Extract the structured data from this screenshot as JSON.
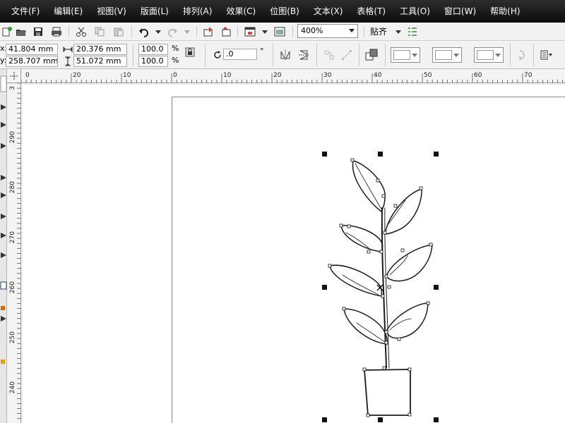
{
  "menu": [
    "文件(F)",
    "编辑(E)",
    "视图(V)",
    "版面(L)",
    "排列(A)",
    "效果(C)",
    "位图(B)",
    "文本(X)",
    "表格(T)",
    "工具(O)",
    "窗口(W)",
    "帮助(H)"
  ],
  "toolbar": {
    "zoom_value": "400%",
    "snap_label": "贴齐"
  },
  "property_bar": {
    "x_label": "x:",
    "y_label": "y:",
    "x_value": "41.804 mm",
    "y_value": "258.707 mm",
    "width_value": "20.376 mm",
    "height_value": "51.072 mm",
    "scale_x": "100.0",
    "scale_y": "100.0",
    "percent": "%",
    "rotation_value": ".0",
    "degree": "°"
  },
  "ruler": {
    "h_labels": [
      "0",
      "20",
      "10",
      "0",
      "10",
      "20",
      "30",
      "40",
      "50",
      "60",
      "70"
    ],
    "v_labels": [
      "3",
      "290",
      "280",
      "270",
      "260",
      "250",
      "240"
    ]
  },
  "colors": {
    "menubar": "#1a1a1a",
    "toolbar_bg": "#f2f2f2",
    "ruler_bg": "#f4f4f4",
    "canvas_bg": "#ffffff"
  }
}
